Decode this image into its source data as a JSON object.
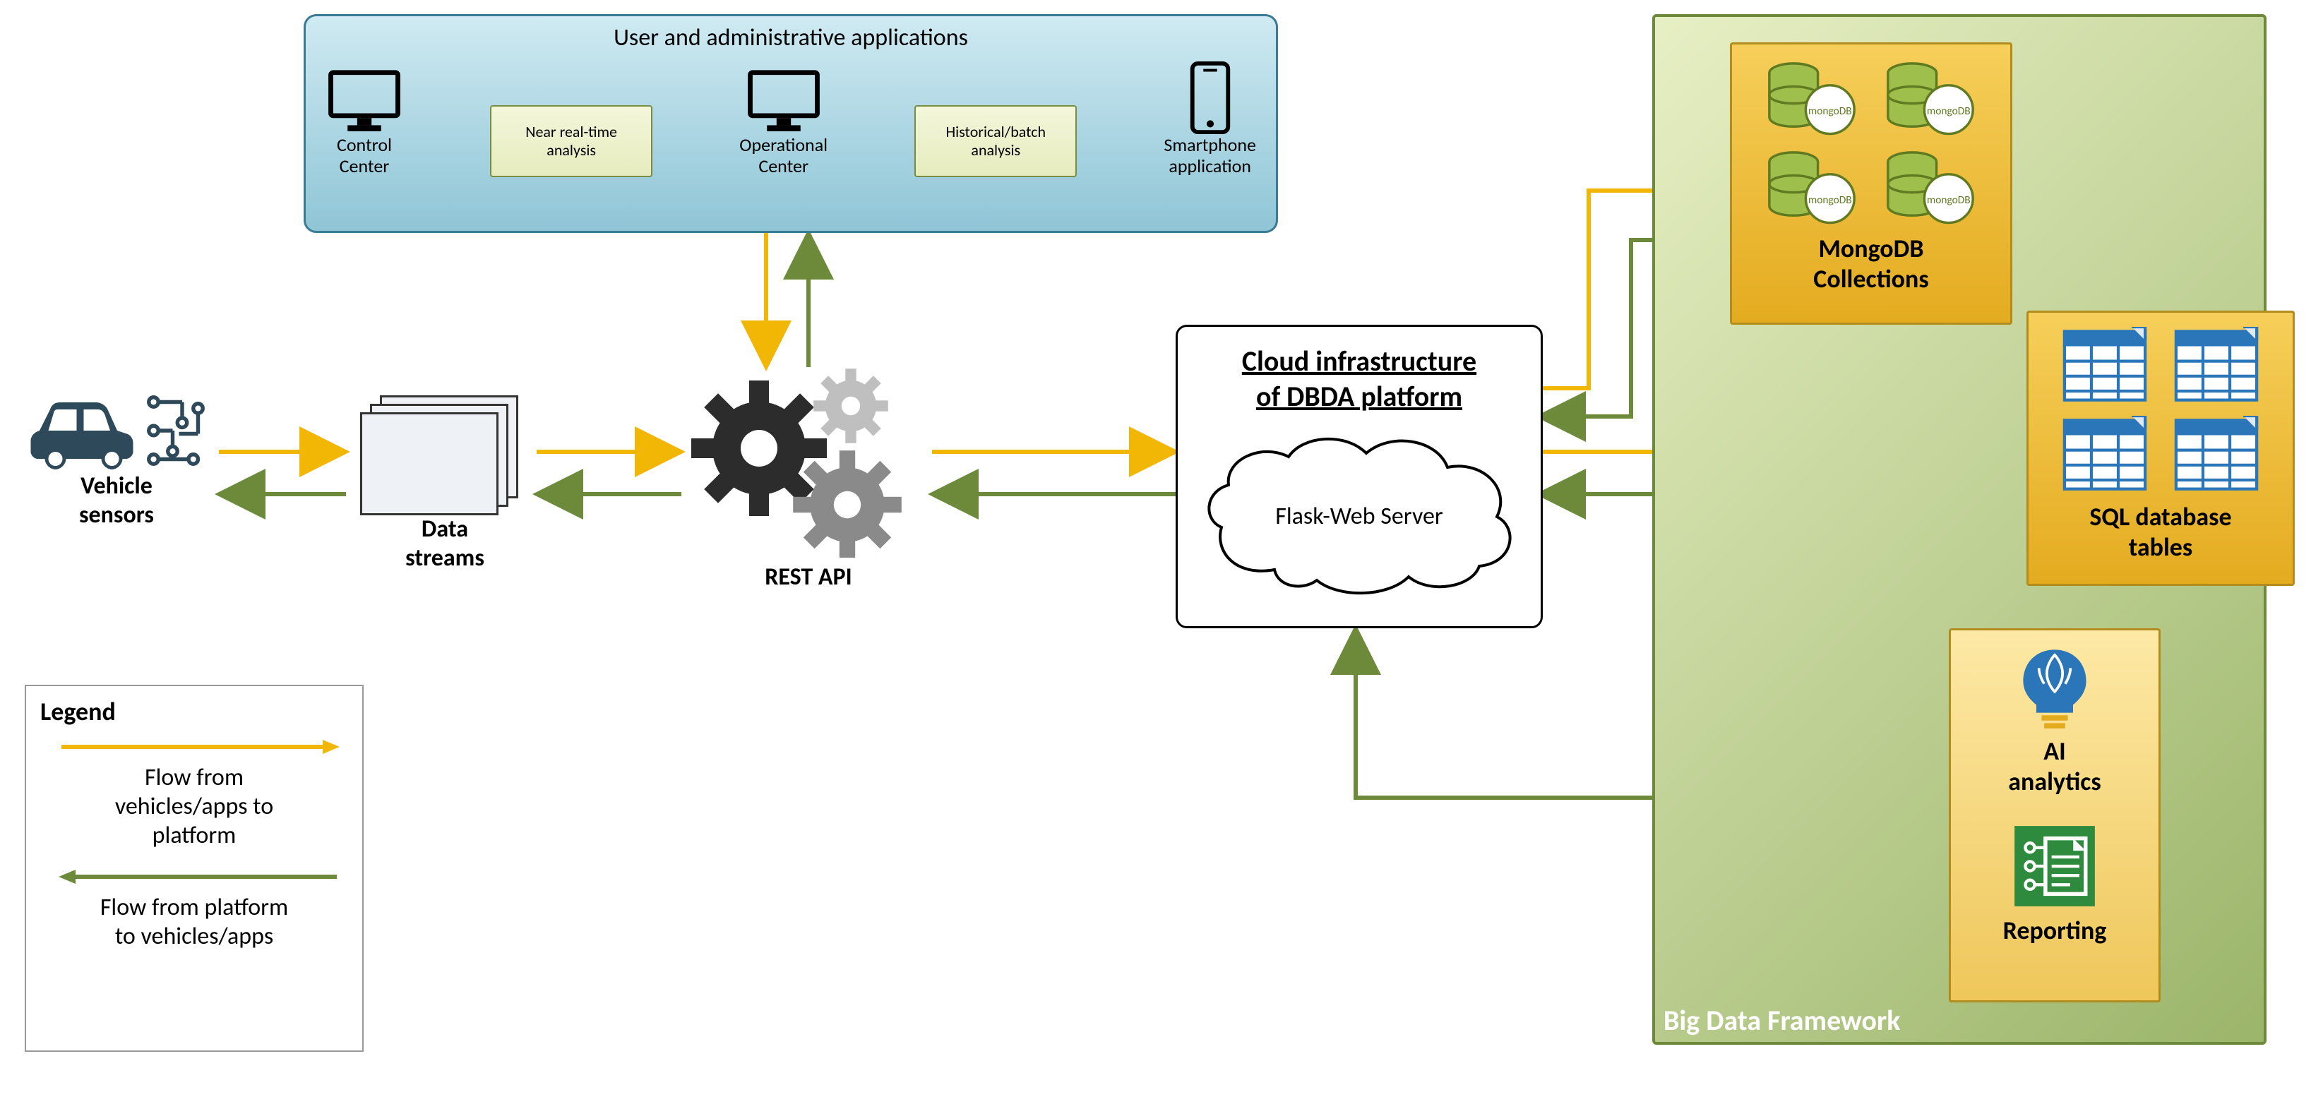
{
  "vehicle_sensors": {
    "label": "Vehicle\nsensors"
  },
  "data_streams": {
    "label": "Data\nstreams"
  },
  "rest_api": {
    "label": "REST API"
  },
  "apps_box": {
    "title": "User and administrative applications",
    "items": {
      "control_center": "Control\nCenter",
      "near_rt": "Near real-time\nanalysis",
      "operational_center": "Operational\nCenter",
      "historical": "Historical/batch\nanalysis",
      "smartphone": "Smartphone\napplication"
    }
  },
  "cloud_box": {
    "title": "Cloud infrastructure\nof DBDA platform",
    "server": "Flask-Web Server"
  },
  "big_data": {
    "title": "Big Data Framework",
    "mongodb": "MongoDB\nCollections",
    "sql": "SQL database\ntables",
    "ai": "AI\nanalytics",
    "reporting": "Reporting"
  },
  "legend": {
    "title": "Legend",
    "flow_in": "Flow from\nvehicles/apps to\nplatform",
    "flow_out": "Flow from platform\nto vehicles/apps"
  },
  "colors": {
    "flow_in": "#f2b705",
    "flow_out": "#6c8a3a"
  }
}
